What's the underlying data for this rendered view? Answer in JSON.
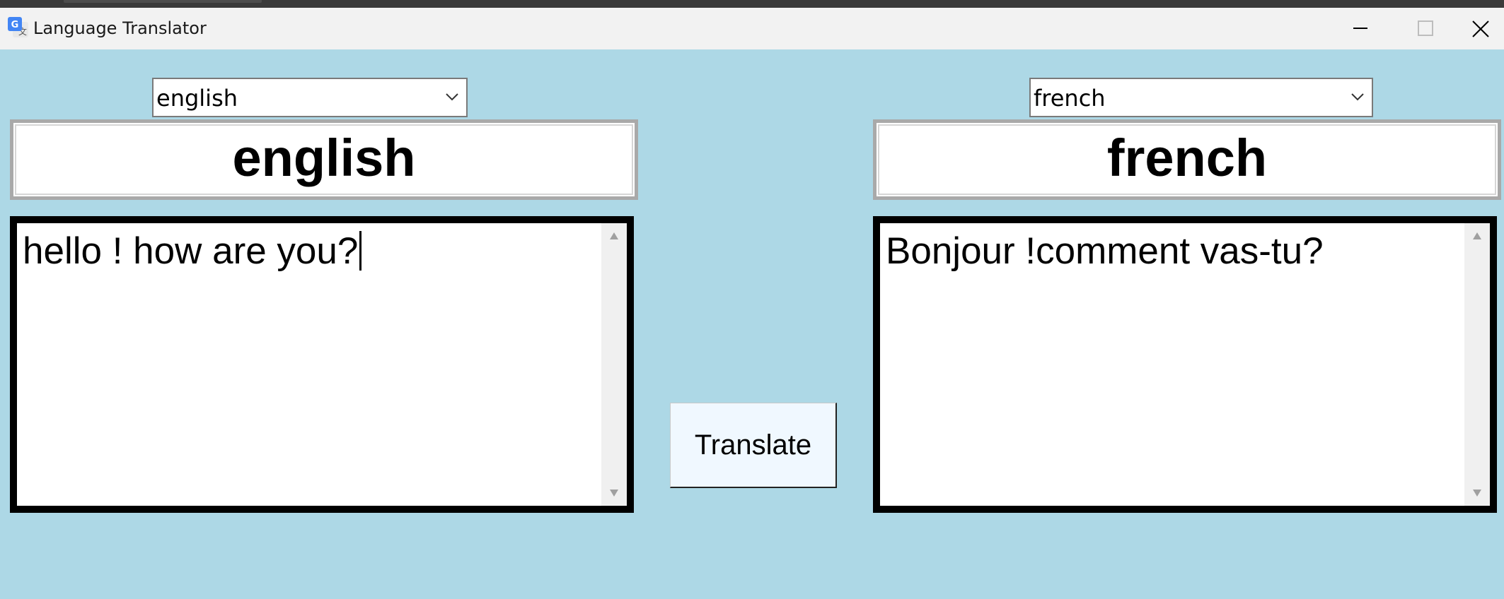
{
  "window": {
    "title": "Language Translator",
    "icon": "google-translate-icon",
    "controls": [
      "minimize-icon",
      "maximize-icon",
      "close-icon"
    ]
  },
  "source": {
    "selected_language": "english",
    "label": "english",
    "text": "hello ! how are you?"
  },
  "target": {
    "selected_language": "french",
    "label": "french",
    "text": "Bonjour !comment vas-tu?"
  },
  "translate_button": {
    "label": "Translate"
  },
  "colors": {
    "background": "#add8e6",
    "button_background": "#f0f8ff",
    "text_border": "#000000",
    "label_border": "#a9a9a9"
  }
}
